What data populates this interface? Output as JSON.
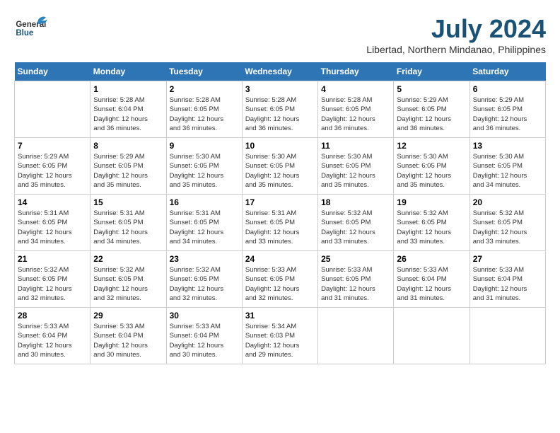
{
  "header": {
    "logo_general": "General",
    "logo_blue": "Blue",
    "title": "July 2024",
    "subtitle": "Libertad, Northern Mindanao, Philippines"
  },
  "calendar": {
    "days_of_week": [
      "Sunday",
      "Monday",
      "Tuesday",
      "Wednesday",
      "Thursday",
      "Friday",
      "Saturday"
    ],
    "weeks": [
      [
        {
          "day": "",
          "info": ""
        },
        {
          "day": "1",
          "info": "Sunrise: 5:28 AM\nSunset: 6:04 PM\nDaylight: 12 hours\nand 36 minutes."
        },
        {
          "day": "2",
          "info": "Sunrise: 5:28 AM\nSunset: 6:05 PM\nDaylight: 12 hours\nand 36 minutes."
        },
        {
          "day": "3",
          "info": "Sunrise: 5:28 AM\nSunset: 6:05 PM\nDaylight: 12 hours\nand 36 minutes."
        },
        {
          "day": "4",
          "info": "Sunrise: 5:28 AM\nSunset: 6:05 PM\nDaylight: 12 hours\nand 36 minutes."
        },
        {
          "day": "5",
          "info": "Sunrise: 5:29 AM\nSunset: 6:05 PM\nDaylight: 12 hours\nand 36 minutes."
        },
        {
          "day": "6",
          "info": "Sunrise: 5:29 AM\nSunset: 6:05 PM\nDaylight: 12 hours\nand 36 minutes."
        }
      ],
      [
        {
          "day": "7",
          "info": "Sunrise: 5:29 AM\nSunset: 6:05 PM\nDaylight: 12 hours\nand 35 minutes."
        },
        {
          "day": "8",
          "info": "Sunrise: 5:29 AM\nSunset: 6:05 PM\nDaylight: 12 hours\nand 35 minutes."
        },
        {
          "day": "9",
          "info": "Sunrise: 5:30 AM\nSunset: 6:05 PM\nDaylight: 12 hours\nand 35 minutes."
        },
        {
          "day": "10",
          "info": "Sunrise: 5:30 AM\nSunset: 6:05 PM\nDaylight: 12 hours\nand 35 minutes."
        },
        {
          "day": "11",
          "info": "Sunrise: 5:30 AM\nSunset: 6:05 PM\nDaylight: 12 hours\nand 35 minutes."
        },
        {
          "day": "12",
          "info": "Sunrise: 5:30 AM\nSunset: 6:05 PM\nDaylight: 12 hours\nand 35 minutes."
        },
        {
          "day": "13",
          "info": "Sunrise: 5:30 AM\nSunset: 6:05 PM\nDaylight: 12 hours\nand 34 minutes."
        }
      ],
      [
        {
          "day": "14",
          "info": "Sunrise: 5:31 AM\nSunset: 6:05 PM\nDaylight: 12 hours\nand 34 minutes."
        },
        {
          "day": "15",
          "info": "Sunrise: 5:31 AM\nSunset: 6:05 PM\nDaylight: 12 hours\nand 34 minutes."
        },
        {
          "day": "16",
          "info": "Sunrise: 5:31 AM\nSunset: 6:05 PM\nDaylight: 12 hours\nand 34 minutes."
        },
        {
          "day": "17",
          "info": "Sunrise: 5:31 AM\nSunset: 6:05 PM\nDaylight: 12 hours\nand 33 minutes."
        },
        {
          "day": "18",
          "info": "Sunrise: 5:32 AM\nSunset: 6:05 PM\nDaylight: 12 hours\nand 33 minutes."
        },
        {
          "day": "19",
          "info": "Sunrise: 5:32 AM\nSunset: 6:05 PM\nDaylight: 12 hours\nand 33 minutes."
        },
        {
          "day": "20",
          "info": "Sunrise: 5:32 AM\nSunset: 6:05 PM\nDaylight: 12 hours\nand 33 minutes."
        }
      ],
      [
        {
          "day": "21",
          "info": "Sunrise: 5:32 AM\nSunset: 6:05 PM\nDaylight: 12 hours\nand 32 minutes."
        },
        {
          "day": "22",
          "info": "Sunrise: 5:32 AM\nSunset: 6:05 PM\nDaylight: 12 hours\nand 32 minutes."
        },
        {
          "day": "23",
          "info": "Sunrise: 5:32 AM\nSunset: 6:05 PM\nDaylight: 12 hours\nand 32 minutes."
        },
        {
          "day": "24",
          "info": "Sunrise: 5:33 AM\nSunset: 6:05 PM\nDaylight: 12 hours\nand 32 minutes."
        },
        {
          "day": "25",
          "info": "Sunrise: 5:33 AM\nSunset: 6:05 PM\nDaylight: 12 hours\nand 31 minutes."
        },
        {
          "day": "26",
          "info": "Sunrise: 5:33 AM\nSunset: 6:04 PM\nDaylight: 12 hours\nand 31 minutes."
        },
        {
          "day": "27",
          "info": "Sunrise: 5:33 AM\nSunset: 6:04 PM\nDaylight: 12 hours\nand 31 minutes."
        }
      ],
      [
        {
          "day": "28",
          "info": "Sunrise: 5:33 AM\nSunset: 6:04 PM\nDaylight: 12 hours\nand 30 minutes."
        },
        {
          "day": "29",
          "info": "Sunrise: 5:33 AM\nSunset: 6:04 PM\nDaylight: 12 hours\nand 30 minutes."
        },
        {
          "day": "30",
          "info": "Sunrise: 5:33 AM\nSunset: 6:04 PM\nDaylight: 12 hours\nand 30 minutes."
        },
        {
          "day": "31",
          "info": "Sunrise: 5:34 AM\nSunset: 6:03 PM\nDaylight: 12 hours\nand 29 minutes."
        },
        {
          "day": "",
          "info": ""
        },
        {
          "day": "",
          "info": ""
        },
        {
          "day": "",
          "info": ""
        }
      ]
    ]
  }
}
